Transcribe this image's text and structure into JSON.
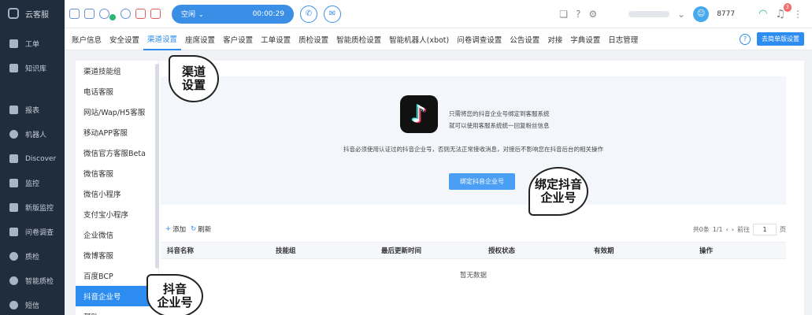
{
  "sidebar": {
    "brand": "云客服",
    "items": [
      {
        "label": "工单",
        "icon": "ticket-icon"
      },
      {
        "label": "知识库",
        "icon": "book-icon"
      },
      {
        "label": "报表",
        "icon": "bar-chart-icon"
      },
      {
        "label": "机器人",
        "icon": "robot-icon"
      },
      {
        "label": "Discover",
        "icon": "discover-icon"
      },
      {
        "label": "监控",
        "icon": "monitor-icon"
      },
      {
        "label": "新版监控",
        "icon": "monitor-new-icon"
      },
      {
        "label": "问卷调查",
        "icon": "survey-icon"
      },
      {
        "label": "质检",
        "icon": "shield-icon"
      },
      {
        "label": "智能质检",
        "icon": "smart-check-icon"
      },
      {
        "label": "短信",
        "icon": "sms-icon"
      }
    ]
  },
  "topbar": {
    "status": "空闲",
    "timer": "00:00:29",
    "user_id": "8777",
    "notification_count": "3"
  },
  "tabs": [
    "账户信息",
    "安全设置",
    "渠道设置",
    "座席设置",
    "客户设置",
    "工单设置",
    "质检设置",
    "智能质检设置",
    "智能机器人(xbot)",
    "问卷调查设置",
    "公告设置",
    "对接",
    "字典设置",
    "日志管理"
  ],
  "active_tab": "渠道设置",
  "simple_settings_label": "去简单版设置",
  "sub_menu": [
    "渠道技能组",
    "电话客服",
    "网站/Wap/H5客服",
    "移动APP客服",
    "微信官方客服Beta",
    "微信客服",
    "微信小程序",
    "支付宝小程序",
    "企业微信",
    "微博客服",
    "百度BCP",
    "抖音企业号",
    "帮助"
  ],
  "active_sub": "抖音企业号",
  "panel": {
    "line1": "只需将您的抖音企业号绑定到客服系统",
    "line2": "就可以使用客服系统统一回复粉丝信息",
    "note": "抖音必须使用认证过的抖音企业号，否则无法正常接收消息，对接后不影响您在抖音后台的相关操作",
    "bind_button": "绑定抖音企业号"
  },
  "toolbar": {
    "add": "添加",
    "refresh": "刷新",
    "total": "共0条",
    "page_info": "1/1",
    "goto": "前往",
    "page_value": "1",
    "page_unit": "页"
  },
  "table": {
    "columns": [
      "抖音名称",
      "技能组",
      "最后更新时间",
      "授权状态",
      "有效期",
      "操作"
    ],
    "empty": "暂无数据"
  },
  "callouts": {
    "channel": [
      "渠道",
      "设置"
    ],
    "bind": [
      "绑定抖音",
      "企业号"
    ],
    "douyin": [
      "抖音",
      "企业号"
    ]
  }
}
